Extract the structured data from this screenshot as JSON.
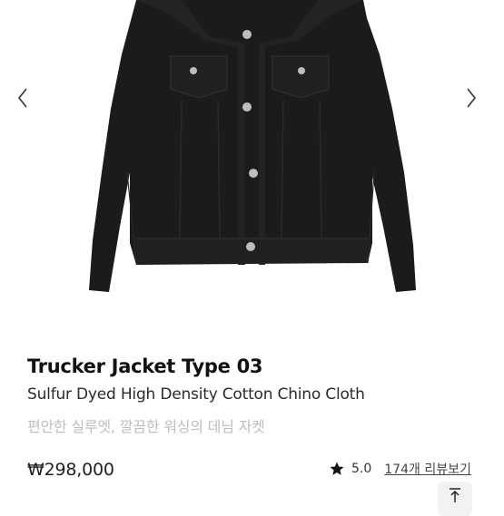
{
  "gallery": {
    "image_alt": "black trucker jacket product photo",
    "prev_icon": "chevron-left-icon",
    "next_icon": "chevron-right-icon"
  },
  "product": {
    "name": "Trucker Jacket Type 03",
    "material": "Sulfur Dyed High Density Cotton Chino Cloth",
    "description": "편안한 실루엣, 깔끔한 워싱의 데님 자켓",
    "price": "₩298,000"
  },
  "rating": {
    "icon": "star-icon",
    "score": "5.0",
    "reviews_link": "174개 리뷰보기"
  },
  "scroll_top": {
    "icon": "arrow-up-to-top-icon"
  },
  "colors": {
    "jacket": "#1b1b1b",
    "description_text": "#bdbdbd",
    "scroll_button_bg": "#f2f2f2"
  }
}
